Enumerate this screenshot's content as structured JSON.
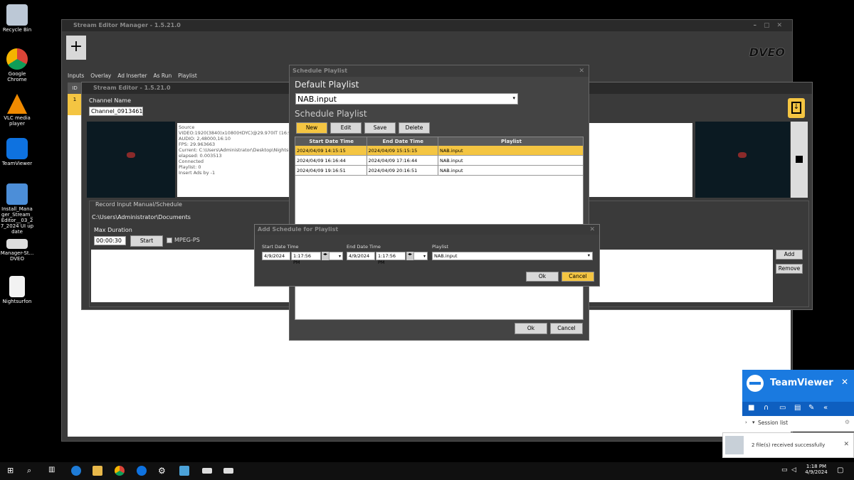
{
  "desktop": {
    "icons": [
      {
        "label": "Recycle Bin",
        "icon": "recycle-bin-icon"
      },
      {
        "label": "Google Chrome",
        "icon": "chrome-icon"
      },
      {
        "label": "VLC media player",
        "icon": "vlc-icon"
      },
      {
        "label": "TeamViewer",
        "icon": "teamviewer-icon"
      },
      {
        "label": "Install_Manager_Stream_Editor__03_27_2024 UI update",
        "icon": "installer-icon"
      },
      {
        "label": "Manager-St... DVEO",
        "icon": "shortcut-icon"
      },
      {
        "label": "Nightsurfon",
        "icon": "file-icon"
      }
    ]
  },
  "manager": {
    "title": "Stream Editor Manager - 1.5.21.0",
    "add_button": "+",
    "logo": "DVEO",
    "tabs": [
      "Inputs",
      "Overlay",
      "Ad Inserter",
      "As Run",
      "Playlist"
    ],
    "id_col": "ID",
    "id_value": "1"
  },
  "editor": {
    "title": "Stream Editor - 1.5.21.0",
    "channel_name_label": "Channel Name",
    "channel_name_value": "Channel_0913461",
    "info_lines": [
      "Source",
      "VIDEO:1920(3840)x1080(HDYC)@29.970IT (16:9)",
      "AUDIO: 2,48000,16:10",
      "FPS: 29.963663",
      "Current: C:\\Users\\Administrator\\Desktop\\Nightsurfo",
      "elapsed: 0.003513",
      "Connected",
      "Playlist:  0",
      "Insert Ads by -1"
    ],
    "record_title": "Record Input Manual/Schedule",
    "record_path": "C:\\Users\\Administrator\\Documents",
    "max_duration_label": "Max Duration",
    "max_duration_value": "00:00:30",
    "start_label": "Start",
    "mpeg_label": "MPEG-PS",
    "add_label": "Add",
    "remove_label": "Remove"
  },
  "schedule": {
    "title": "Schedule Playlist",
    "default_label": "Default Playlist",
    "default_value": "NAB.input",
    "section_label": "Schedule Playlist",
    "buttons": {
      "new": "New",
      "edit": "Edit",
      "save": "Save",
      "delete": "Delete"
    },
    "columns": [
      "Start Date Time",
      "End Date Time",
      "Playlist"
    ],
    "rows": [
      {
        "start": "2024/04/09 14:15:15",
        "end": "2024/04/09 15:15:15",
        "playlist": "NAB.input"
      },
      {
        "start": "2024/04/09 16:16:44",
        "end": "2024/04/09 17:16:44",
        "playlist": "NAB.input"
      },
      {
        "start": "2024/04/09 19:16:51",
        "end": "2024/04/09 20:16:51",
        "playlist": "NAB.input"
      }
    ],
    "ok": "Ok",
    "cancel": "Cancel"
  },
  "add_schedule": {
    "title": "Add Schedule for Playlist",
    "start_label": "Start Date Time",
    "start_date": "4/9/2024",
    "start_time": "1:17:56 PM",
    "end_label": "End Date Time",
    "end_date": "4/9/2024",
    "end_time": "1:17:56 PM",
    "playlist_label": "Playlist",
    "playlist_value": "NAB.input",
    "ok": "Ok",
    "cancel": "Cancel"
  },
  "teamviewer": {
    "title": "TeamViewer",
    "session_list": "Session list",
    "notification": "2 file(s) received successfully"
  },
  "taskbar": {
    "time": "1:18 PM",
    "date": "4/9/2024"
  },
  "colors": {
    "accent": "#f4c542",
    "teamviewer": "#1a7ae0"
  }
}
